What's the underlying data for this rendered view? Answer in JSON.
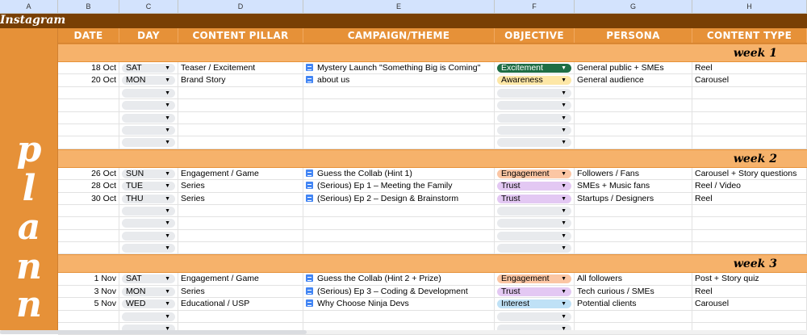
{
  "columns": [
    "A",
    "B",
    "C",
    "D",
    "E",
    "F",
    "G",
    "H"
  ],
  "title": "Instagram",
  "side_letters": [
    "p",
    "l",
    "a",
    "n",
    "n"
  ],
  "headers": [
    "DATE",
    "DAY",
    "CONTENT PILLAR",
    "CAMPAIGN/THEME",
    "OBJECTIVE",
    "PERSONA",
    "CONTENT TYPE"
  ],
  "colors": {
    "title_bar": "#783f04",
    "header": "#e69138",
    "week": "#f6b26b"
  },
  "objective_colors": {
    "Excitement": [
      "#1e6e45",
      "#ffffff"
    ],
    "Awareness": [
      "#fde7a6",
      "#000000"
    ],
    "Engagement": [
      "#fbc6a4",
      "#000000"
    ],
    "Trust": [
      "#e3c8f3",
      "#000000"
    ],
    "Interest": [
      "#bfe1f6",
      "#000000"
    ]
  },
  "weeks": [
    {
      "label": "week 1",
      "rows": [
        {
          "date": "18 Oct",
          "day": "SAT",
          "pillar": "Teaser / Excitement",
          "campaign": "Mystery Launch \"Something Big is Coming\"",
          "objective": "Excitement",
          "persona": "General public + SMEs",
          "type": "Reel"
        },
        {
          "date": "20 Oct",
          "day": "MON",
          "pillar": "Brand Story",
          "campaign": "about us",
          "objective": "Awareness",
          "persona": "General audience",
          "type": "Carousel"
        },
        {},
        {},
        {},
        {},
        {}
      ]
    },
    {
      "label": "week 2",
      "rows": [
        {
          "date": "26 Oct",
          "day": "SUN",
          "pillar": "Engagement / Game",
          "campaign": "Guess the Collab (Hint 1)",
          "objective": "Engagement",
          "persona": "Followers / Fans",
          "type": "Carousel + Story questions"
        },
        {
          "date": "28 Oct",
          "day": "TUE",
          "pillar": "Series",
          "campaign": "(Serious) Ep 1 – Meeting the Family",
          "objective": "Trust",
          "persona": "SMEs + Music fans",
          "type": "Reel / Video"
        },
        {
          "date": "30 Oct",
          "day": "THU",
          "pillar": "Series",
          "campaign": "(Serious) Ep 2 – Design & Brainstorm",
          "objective": "Trust",
          "persona": "Startups / Designers",
          "type": "Reel"
        },
        {},
        {},
        {},
        {}
      ]
    },
    {
      "label": "week 3",
      "rows": [
        {
          "date": "1 Nov",
          "day": "SAT",
          "pillar": "Engagement / Game",
          "campaign": "Guess the Collab (Hint 2 + Prize)",
          "objective": "Engagement",
          "persona": "All followers",
          "type": "Post + Story quiz"
        },
        {
          "date": "3 Nov",
          "day": "MON",
          "pillar": "Series",
          "campaign": "(Serious) Ep 3 – Coding & Development",
          "objective": "Trust",
          "persona": "Tech curious / SMEs",
          "type": "Reel"
        },
        {
          "date": "5 Nov",
          "day": "WED",
          "pillar": "Educational / USP",
          "campaign": "Why Choose Ninja Devs",
          "objective": "Interest",
          "persona": "Potential clients",
          "type": "Carousel"
        },
        {},
        {}
      ]
    }
  ]
}
